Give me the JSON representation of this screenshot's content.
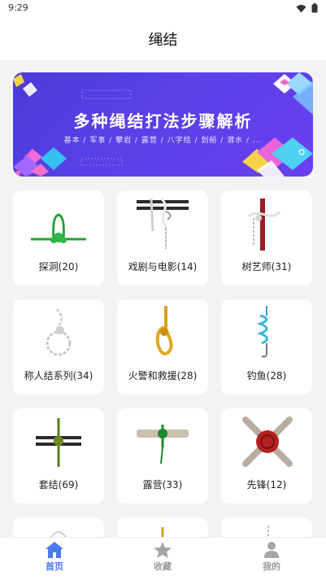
{
  "status": {
    "time": "9:29"
  },
  "header": {
    "title": "绳结"
  },
  "banner": {
    "title": "多种绳结打法步骤解析",
    "subtitle": "基本 / 军事 / 攀岩 / 露营 / 八字结 / 划船 / 潜水 / ..."
  },
  "categories": [
    {
      "label": "探洞(20)",
      "icon": "green-loop-knot-icon"
    },
    {
      "label": "戏剧与电影(14)",
      "icon": "white-rope-on-bar-icon"
    },
    {
      "label": "树艺师(31)",
      "icon": "red-pole-knot-icon"
    },
    {
      "label": "称人结系列(34)",
      "icon": "white-bowline-icon"
    },
    {
      "label": "火警和救援(28)",
      "icon": "yellow-loop-knot-icon"
    },
    {
      "label": "钓鱼(28)",
      "icon": "blue-fishing-knot-icon"
    },
    {
      "label": "套结(69)",
      "icon": "green-bar-hitch-icon"
    },
    {
      "label": "露营(33)",
      "icon": "green-pole-hitch-icon"
    },
    {
      "label": "先锋(12)",
      "icon": "red-lashing-icon"
    }
  ],
  "nav": {
    "home": "首页",
    "favorites": "收藏",
    "profile": "我的",
    "active_color": "#4a78f0",
    "inactive_color": "#9a9a9a"
  }
}
